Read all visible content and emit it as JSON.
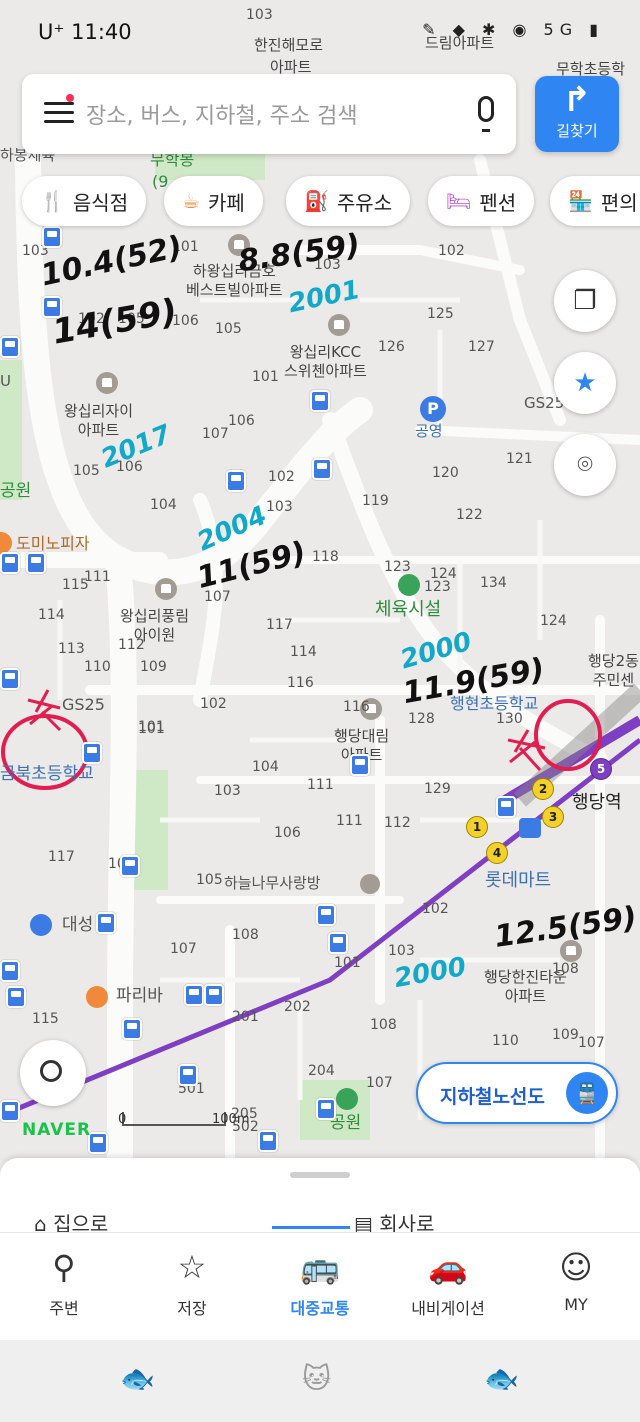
{
  "status_bar": {
    "carrier_time": "U⁺ 11:40",
    "right_icons": "✎ ◆ ✱ ◉ 5G ▮"
  },
  "search": {
    "placeholder": "장소, 버스, 지하철, 주소 검색"
  },
  "route_button": {
    "label": "길찾기"
  },
  "chips": [
    {
      "icon": "🍴",
      "label": "음식점"
    },
    {
      "icon": "☕",
      "label": "카페"
    },
    {
      "icon": "⛽",
      "label": "주유소"
    },
    {
      "icon": "🛏",
      "label": "펜션"
    },
    {
      "icon": "🏪",
      "label": "편의"
    }
  ],
  "map": {
    "top_labels": [
      "103",
      "한진해모로",
      "아파트",
      "드림아파트",
      "무학초등학",
      "무학봉",
      "무학",
      "(9",
      "하봉체육",
      "103"
    ],
    "buildings": [
      {
        "name": "하왕십리금호\n베스트빌아파트"
      },
      {
        "name": "왕십리KCC\n스위첸아파트"
      },
      {
        "name": "왕십리자이\n아파트"
      },
      {
        "name": "왕십리풍림\n아이원"
      },
      {
        "name": "행당대림\n아파트"
      },
      {
        "name": "행당한진타운\n아파트"
      }
    ],
    "places": [
      "공영",
      "체육시설",
      "행당2동\n주민센",
      "행현초등학교",
      "행당역",
      "롯데마트",
      "하늘나무사랑방",
      "대성",
      "파리바",
      "공원",
      "금북초등학교",
      "도미노피자",
      "GS25",
      "GS25",
      "공원",
      "U"
    ],
    "block_numbers": [
      "103",
      "102",
      "101",
      "106",
      "105",
      "107",
      "104",
      "101",
      "102",
      "103",
      "105",
      "106",
      "107",
      "102",
      "103",
      "118",
      "119",
      "120",
      "122",
      "121",
      "125",
      "126",
      "127",
      "123",
      "124",
      "134",
      "117",
      "116",
      "115",
      "114",
      "113",
      "112",
      "111",
      "110",
      "109",
      "114",
      "111",
      "102",
      "101",
      "104",
      "103",
      "106",
      "105",
      "108",
      "107",
      "109",
      "116",
      "128",
      "129",
      "130",
      "111",
      "112",
      "102",
      "103",
      "101",
      "108",
      "110",
      "202",
      "201",
      "204",
      "205",
      "107",
      "115",
      "501",
      "502",
      "101",
      "107",
      "108",
      "109",
      "117",
      "123",
      "124",
      "105",
      "106"
    ],
    "station_exits": [
      "1",
      "2",
      "3",
      "4",
      "5"
    ],
    "scale": {
      "left": "0",
      "right": "100m"
    },
    "brand": "NAVER"
  },
  "annotations": {
    "black": [
      "10.4(52)",
      "14(59)",
      "8.8(59)",
      "11(59)",
      "11.9(59)",
      "12.5(59)"
    ],
    "teal": [
      "2001",
      "2017",
      "2004",
      "2000",
      "2000"
    ]
  },
  "subway_map_button": {
    "label": "지하철노선도"
  },
  "bottom_sheet": {
    "home": "집으로",
    "work": "회사로"
  },
  "bottom_nav": [
    {
      "icon": "pin-icon",
      "label": "주변"
    },
    {
      "icon": "star-icon",
      "label": "저장"
    },
    {
      "icon": "bus-icon",
      "label": "대중교통"
    },
    {
      "icon": "car-icon",
      "label": "내비게이션"
    },
    {
      "icon": "person-icon",
      "label": "MY"
    }
  ],
  "colors": {
    "accent": "#2f86f2",
    "subway_line_5": "#7e3fc2",
    "annotation_red": "#e21d4f",
    "annotation_teal": "#12a8c9",
    "park": "#cfe8c6"
  }
}
